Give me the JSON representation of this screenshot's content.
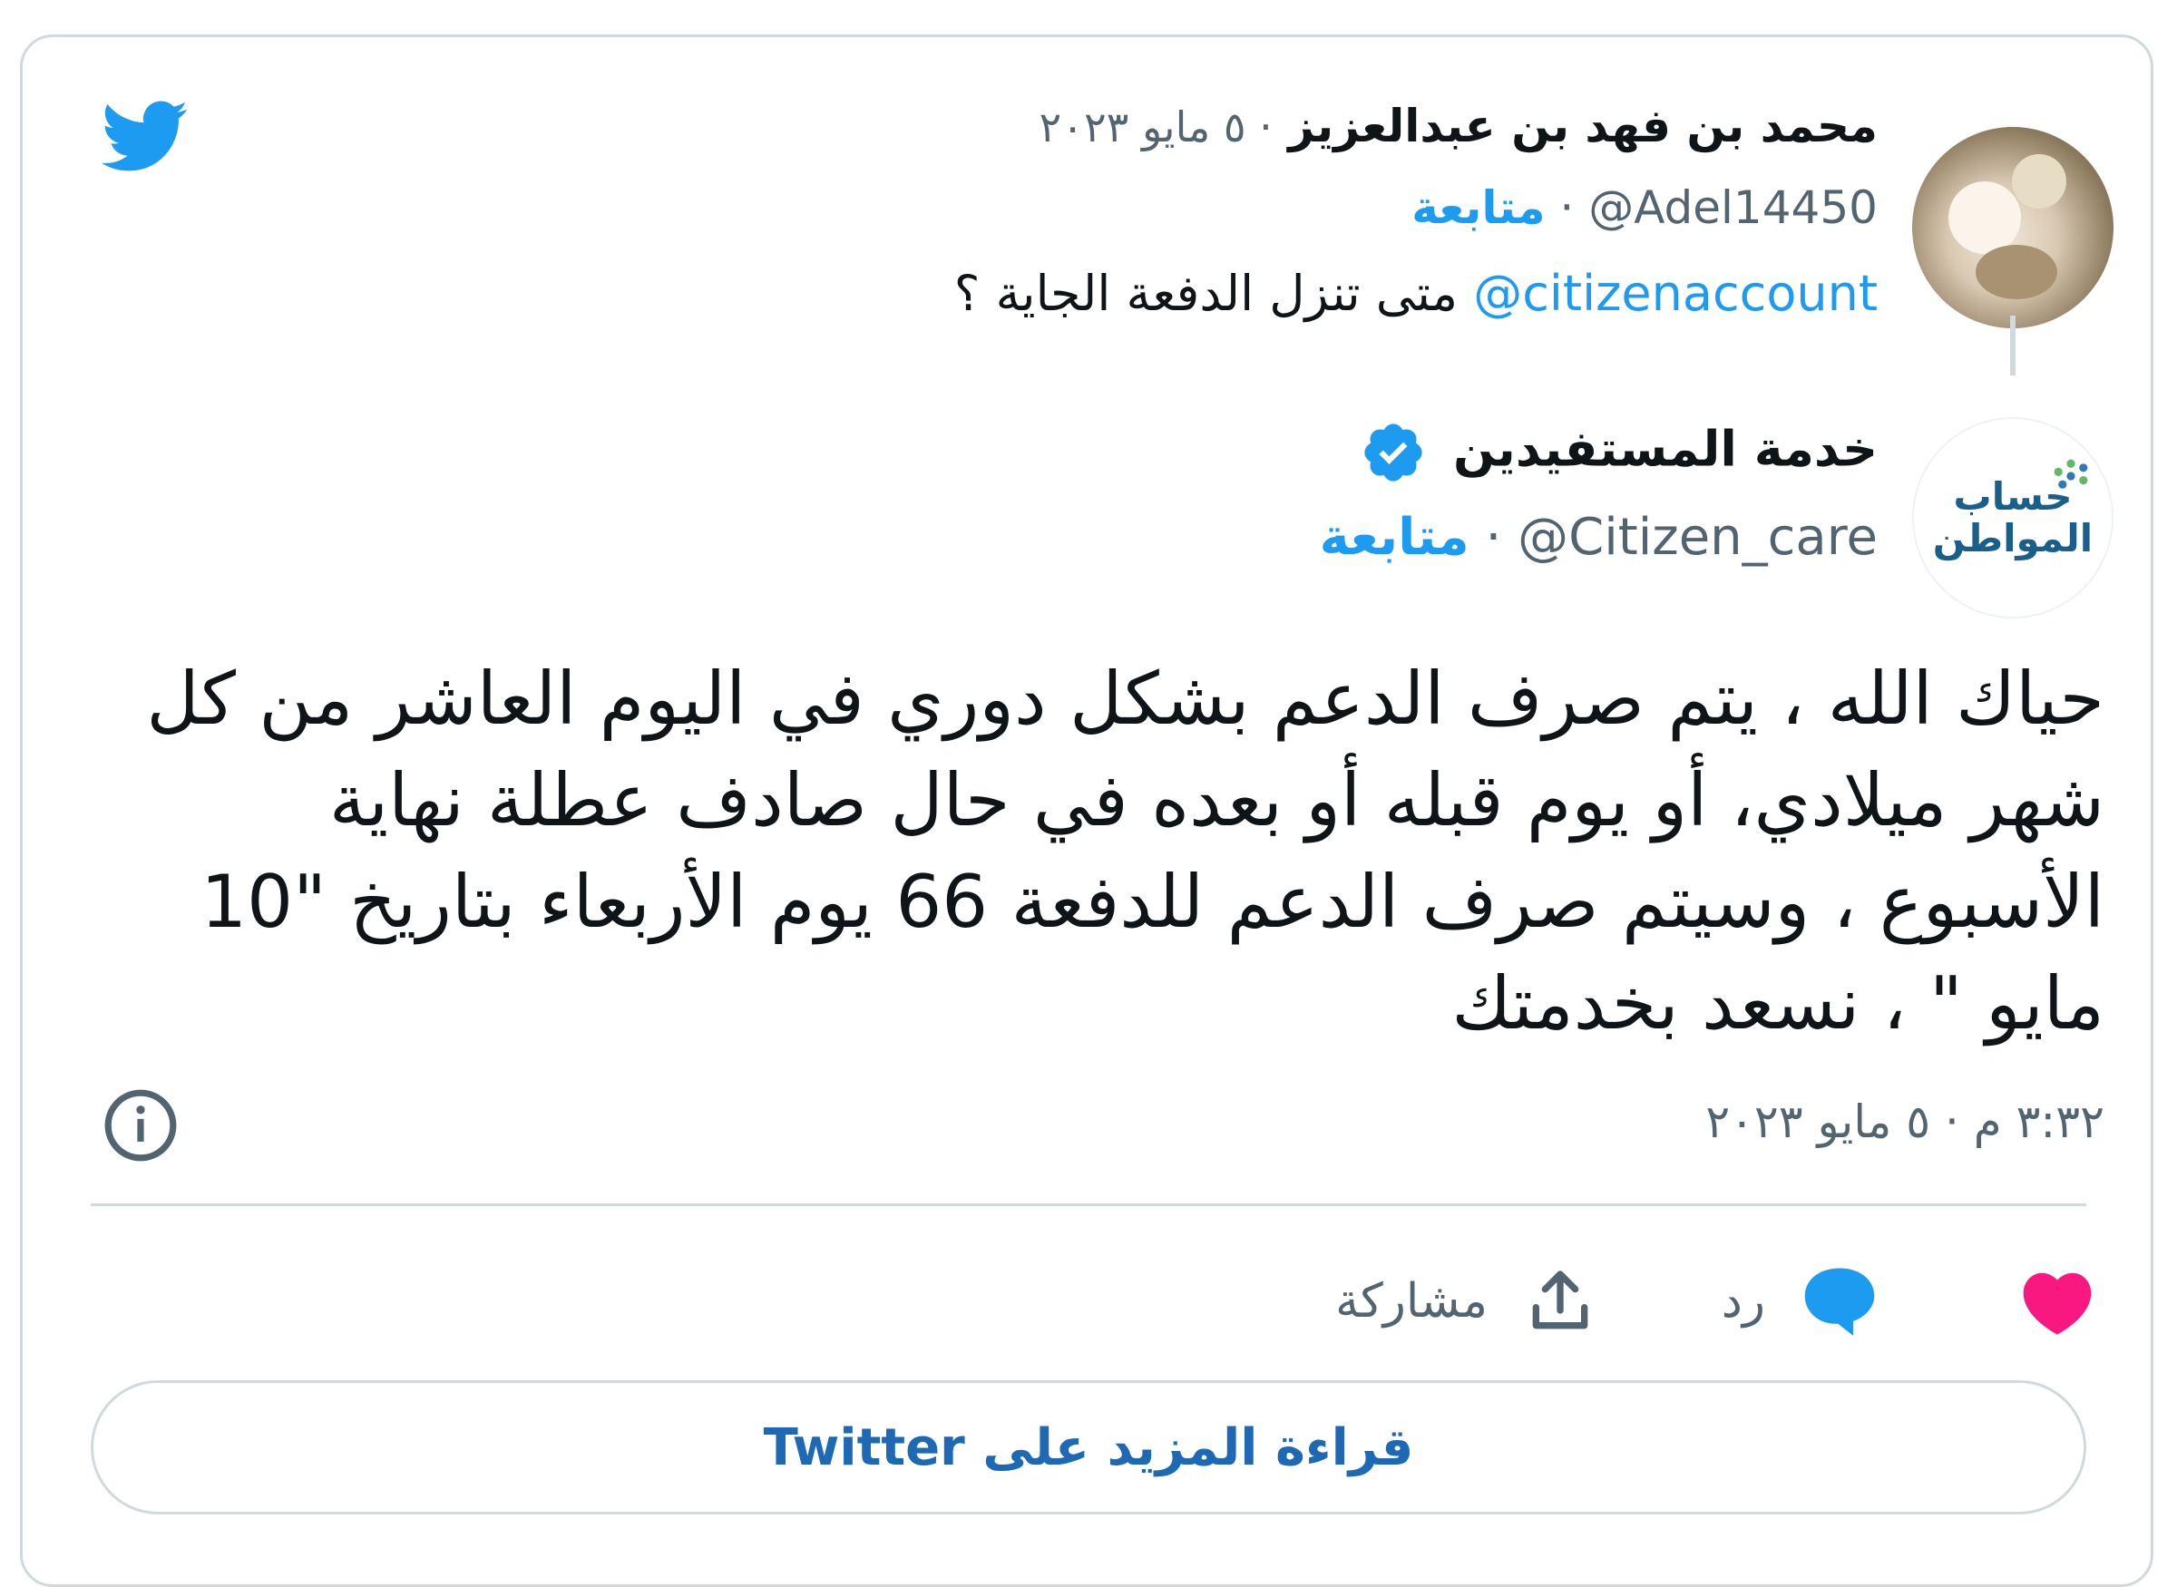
{
  "colors": {
    "accent": "#1d9bf0",
    "like": "#f91880",
    "muted": "#536471",
    "border": "#cfd9de"
  },
  "icons": {
    "brand": "twitter-bird-icon",
    "verified": "verified-badge-icon",
    "info": "info-icon",
    "like": "heart-icon",
    "reply": "reply-bubble-icon",
    "share": "share-upload-icon"
  },
  "replied_tweet": {
    "name": "محمد بن فهد بن عبدالعزيز",
    "date": "· ٥ مايو ٢٠٢٣",
    "handle": "@Adel14450",
    "handle_sep": " · ",
    "follow_label": "متابعة",
    "mention": "@citizenaccount",
    "text": " متى تنزل الدفعة الجاية ؟"
  },
  "main_tweet": {
    "avatar_line1": "حساب",
    "avatar_line2": "المواطن",
    "name": "خدمة المستفيدين",
    "handle": "@Citizen_care",
    "handle_sep": " · ",
    "follow_label": "متابعة",
    "body": "حياك الله ، يتم صرف الدعم بشكل دوري في اليوم العاشر من كل شهر ميلادي، أو يوم قبله أو بعده في حال صادف عطلة نهاية الأسبوع ، وسيتم صرف الدعم للدفعة 66 يوم الأربعاء بتاريخ \"10 مايو \" ، نسعد بخدمتك",
    "timestamp": "٣:٣٢ م · ٥ مايو ٢٠٢٣"
  },
  "actions": {
    "reply_label": "رد",
    "share_label": "مشاركة"
  },
  "read_more_label": "قراءة المزيد على Twitter"
}
